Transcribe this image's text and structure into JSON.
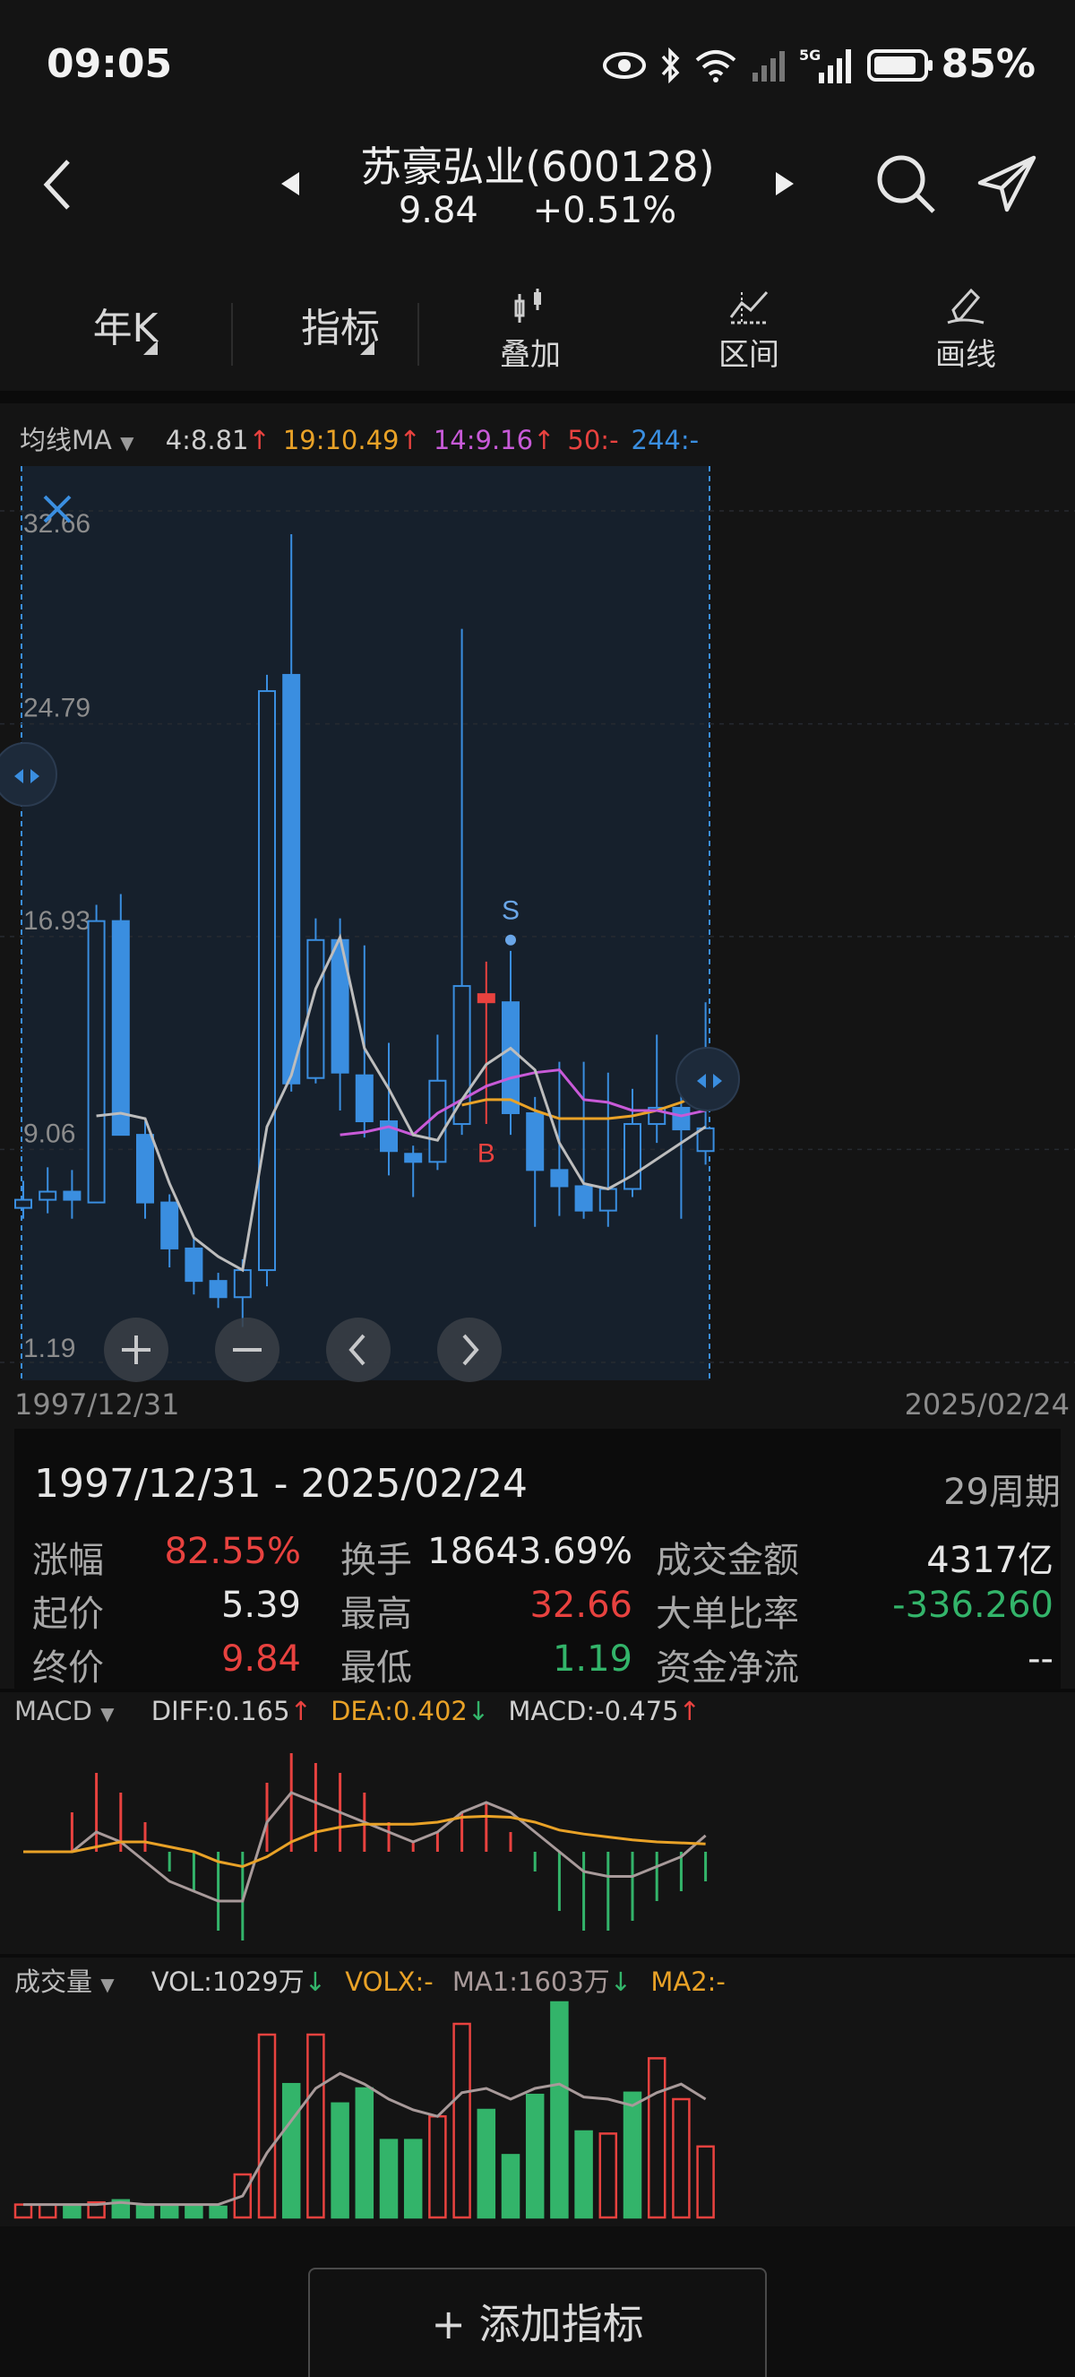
{
  "status_bar": {
    "time": "09:05",
    "battery": "85%",
    "network": "5G"
  },
  "header": {
    "stock_name": "苏豪弘业(600128)",
    "price": "9.84",
    "change": "+0.51%",
    "colors": {
      "up": "#e8423f",
      "down": "#33b46a"
    }
  },
  "toolbar": {
    "period": "年K",
    "indicator": "指标",
    "overlay": "叠加",
    "range": "区间",
    "draw": "画线"
  },
  "ma_line": {
    "title": "均线MA",
    "items": [
      {
        "text": "4:8.81",
        "color": "#cfcfcf",
        "arrow": "↑"
      },
      {
        "text": "19:10.49",
        "color": "#e9a227",
        "arrow": "↑"
      },
      {
        "text": "14:9.16",
        "color": "#c85ad8",
        "arrow": "↑"
      },
      {
        "text": "50:-",
        "color": "#e8423f",
        "arrow": ""
      },
      {
        "text": "244:-",
        "color": "#3a8ee0",
        "arrow": ""
      }
    ]
  },
  "main_chart": {
    "y_labels": [
      "32.66",
      "24.79",
      "16.93",
      "9.06",
      "1.19"
    ],
    "x_start": "1997/12/31",
    "x_end": "2025/02/24",
    "ymin": 1.19,
    "ymax": 32.66,
    "marker_b": "B",
    "marker_s": "S",
    "candles": [
      {
        "o": 6.9,
        "c": 7.2,
        "h": 7.9,
        "l": 6.5,
        "dir": "up"
      },
      {
        "o": 7.2,
        "c": 7.5,
        "h": 8.4,
        "l": 6.7,
        "dir": "up"
      },
      {
        "o": 7.5,
        "c": 7.2,
        "h": 8.3,
        "l": 6.5,
        "dir": "down"
      },
      {
        "o": 7.1,
        "c": 17.5,
        "h": 18.1,
        "l": 7.1,
        "dir": "up"
      },
      {
        "o": 17.5,
        "c": 9.6,
        "h": 18.5,
        "l": 9.6,
        "dir": "down"
      },
      {
        "o": 9.6,
        "c": 7.1,
        "h": 10.1,
        "l": 6.5,
        "dir": "down"
      },
      {
        "o": 7.1,
        "c": 5.4,
        "h": 7.4,
        "l": 4.7,
        "dir": "down"
      },
      {
        "o": 5.4,
        "c": 4.2,
        "h": 5.8,
        "l": 3.7,
        "dir": "down"
      },
      {
        "o": 4.2,
        "c": 3.6,
        "h": 4.5,
        "l": 3.2,
        "dir": "down"
      },
      {
        "o": 3.6,
        "c": 4.6,
        "h": 5.0,
        "l": 2.5,
        "dir": "up"
      },
      {
        "o": 4.6,
        "c": 26.0,
        "h": 26.6,
        "l": 4.0,
        "dir": "up"
      },
      {
        "o": 26.6,
        "c": 11.5,
        "h": 31.8,
        "l": 11.2,
        "dir": "down"
      },
      {
        "o": 11.7,
        "c": 16.8,
        "h": 17.6,
        "l": 11.5,
        "dir": "up"
      },
      {
        "o": 16.8,
        "c": 11.9,
        "h": 17.6,
        "l": 10.5,
        "dir": "down"
      },
      {
        "o": 11.8,
        "c": 10.1,
        "h": 16.6,
        "l": 9.5,
        "dir": "down"
      },
      {
        "o": 10.1,
        "c": 9.0,
        "h": 13.0,
        "l": 8.1,
        "dir": "down"
      },
      {
        "o": 8.9,
        "c": 8.6,
        "h": 9.2,
        "l": 7.3,
        "dir": "down"
      },
      {
        "o": 8.6,
        "c": 11.6,
        "h": 13.3,
        "l": 8.3,
        "dir": "up"
      },
      {
        "o": 10.0,
        "c": 15.1,
        "h": 28.3,
        "l": 9.6,
        "dir": "up"
      },
      {
        "o": 14.8,
        "c": 14.5,
        "h": 16.0,
        "l": 10.0,
        "dir": "red"
      },
      {
        "o": 14.5,
        "c": 10.4,
        "h": 16.4,
        "l": 9.6,
        "dir": "down"
      },
      {
        "o": 10.4,
        "c": 8.3,
        "h": 11.0,
        "l": 6.2,
        "dir": "down"
      },
      {
        "o": 8.3,
        "c": 7.7,
        "h": 12.3,
        "l": 6.6,
        "dir": "down"
      },
      {
        "o": 7.7,
        "c": 6.8,
        "h": 12.3,
        "l": 6.5,
        "dir": "down"
      },
      {
        "o": 6.8,
        "c": 7.6,
        "h": 11.9,
        "l": 6.2,
        "dir": "up"
      },
      {
        "o": 7.6,
        "c": 10.0,
        "h": 11.3,
        "l": 7.3,
        "dir": "up"
      },
      {
        "o": 10.0,
        "c": 10.6,
        "h": 13.3,
        "l": 9.3,
        "dir": "up"
      },
      {
        "o": 10.6,
        "c": 9.8,
        "h": 12.3,
        "l": 6.5,
        "dir": "down"
      },
      {
        "o": 9.0,
        "c": 9.84,
        "h": 14.5,
        "l": 8.5,
        "dir": "up"
      }
    ],
    "ma4": [
      null,
      null,
      null,
      10.3,
      10.4,
      10.2,
      7.8,
      5.8,
      5.1,
      4.6,
      9.9,
      11.8,
      15.0,
      16.9,
      12.8,
      11.3,
      9.6,
      9.4,
      10.9,
      12.2,
      12.8,
      12.0,
      9.3,
      7.8,
      7.6,
      8.1,
      8.7,
      9.3,
      9.9
    ],
    "ma14": [
      null,
      null,
      null,
      null,
      null,
      null,
      null,
      null,
      null,
      null,
      null,
      null,
      null,
      9.6,
      9.7,
      9.9,
      9.6,
      10.4,
      10.9,
      11.4,
      11.7,
      11.9,
      12.0,
      10.9,
      10.8,
      10.5,
      10.5,
      10.3,
      10.5
    ],
    "ma19": [
      null,
      null,
      null,
      null,
      null,
      null,
      null,
      null,
      null,
      null,
      null,
      null,
      null,
      null,
      null,
      null,
      null,
      null,
      10.7,
      10.9,
      10.9,
      10.5,
      10.2,
      10.2,
      10.2,
      10.3,
      10.5,
      10.8,
      11.2
    ]
  },
  "stats": {
    "range": "1997/12/31 - 2025/02/24",
    "periods": "29周期",
    "rows": [
      {
        "l1": "涨幅",
        "v1": "82.55%",
        "c1": "#e8423f",
        "l2": "换手",
        "v2": "18643.69%",
        "c2": "#e6e6e6",
        "l3": "成交金额",
        "v3": "4317亿",
        "c3": "#e6e6e6"
      },
      {
        "l1": "起价",
        "v1": "5.39",
        "c1": "#e6e6e6",
        "l2": "最高",
        "v2": "32.66",
        "c2": "#e8423f",
        "l3": "大单比率",
        "v3": "-336.260",
        "c3": "#33b46a"
      },
      {
        "l1": "终价",
        "v1": "9.84",
        "c1": "#e8423f",
        "l2": "最低",
        "v2": "1.19",
        "c2": "#33b46a",
        "l3": "资金净流",
        "v3": "--",
        "c3": "#e6e6e6"
      }
    ]
  },
  "macd": {
    "title": "MACD",
    "diff": "DIFF:0.165",
    "dea": "DEA:0.402",
    "macd": "MACD:-0.475",
    "diff_line": [
      0,
      0,
      0,
      0.2,
      0.1,
      -0.1,
      -0.3,
      -0.4,
      -0.5,
      -0.5,
      0.3,
      0.6,
      0.5,
      0.4,
      0.3,
      0.2,
      0.1,
      0.2,
      0.4,
      0.5,
      0.4,
      0.2,
      0.0,
      -0.2,
      -0.25,
      -0.25,
      -0.15,
      -0.05,
      0.165
    ],
    "dea_line": [
      0,
      0,
      0,
      0.05,
      0.1,
      0.1,
      0.05,
      0.0,
      -0.1,
      -0.15,
      -0.05,
      0.1,
      0.2,
      0.25,
      0.28,
      0.28,
      0.28,
      0.3,
      0.35,
      0.36,
      0.35,
      0.3,
      0.22,
      0.18,
      0.15,
      0.12,
      0.1,
      0.09,
      0.08
    ],
    "bars": [
      0,
      0,
      0.4,
      0.8,
      0.6,
      0.3,
      -0.2,
      -0.4,
      -0.8,
      -0.9,
      0.7,
      1.0,
      0.9,
      0.8,
      0.6,
      0.3,
      0.1,
      0.2,
      0.4,
      0.5,
      0.2,
      -0.2,
      -0.6,
      -0.8,
      -0.8,
      -0.7,
      -0.5,
      -0.4,
      -0.3
    ]
  },
  "volume": {
    "title": "成交量",
    "vol": "VOL:1029万",
    "volx": "VOLX:-",
    "ma1": "MA1:1603万",
    "ma2": "MA2:-",
    "bars": [
      {
        "v": 0.06,
        "dir": "up"
      },
      {
        "v": 0.06,
        "dir": "up"
      },
      {
        "v": 0.06,
        "dir": "down"
      },
      {
        "v": 0.07,
        "dir": "up"
      },
      {
        "v": 0.08,
        "dir": "down"
      },
      {
        "v": 0.06,
        "dir": "down"
      },
      {
        "v": 0.05,
        "dir": "down"
      },
      {
        "v": 0.05,
        "dir": "down"
      },
      {
        "v": 0.05,
        "dir": "down"
      },
      {
        "v": 0.2,
        "dir": "up"
      },
      {
        "v": 0.85,
        "dir": "up"
      },
      {
        "v": 0.62,
        "dir": "down"
      },
      {
        "v": 0.85,
        "dir": "up"
      },
      {
        "v": 0.53,
        "dir": "down"
      },
      {
        "v": 0.6,
        "dir": "down"
      },
      {
        "v": 0.36,
        "dir": "down"
      },
      {
        "v": 0.36,
        "dir": "down"
      },
      {
        "v": 0.47,
        "dir": "up"
      },
      {
        "v": 0.9,
        "dir": "up"
      },
      {
        "v": 0.5,
        "dir": "down"
      },
      {
        "v": 0.29,
        "dir": "down"
      },
      {
        "v": 0.57,
        "dir": "down"
      },
      {
        "v": 1.0,
        "dir": "down"
      },
      {
        "v": 0.4,
        "dir": "down"
      },
      {
        "v": 0.39,
        "dir": "up"
      },
      {
        "v": 0.58,
        "dir": "down"
      },
      {
        "v": 0.74,
        "dir": "up"
      },
      {
        "v": 0.55,
        "dir": "up"
      },
      {
        "v": 0.33,
        "dir": "up"
      }
    ],
    "ma_line": [
      0.06,
      0.06,
      0.06,
      0.06,
      0.07,
      0.06,
      0.06,
      0.06,
      0.06,
      0.1,
      0.3,
      0.45,
      0.6,
      0.67,
      0.62,
      0.55,
      0.5,
      0.47,
      0.58,
      0.6,
      0.55,
      0.6,
      0.62,
      0.56,
      0.55,
      0.52,
      0.58,
      0.62,
      0.55
    ]
  },
  "add_indicator": "+ 添加指标"
}
